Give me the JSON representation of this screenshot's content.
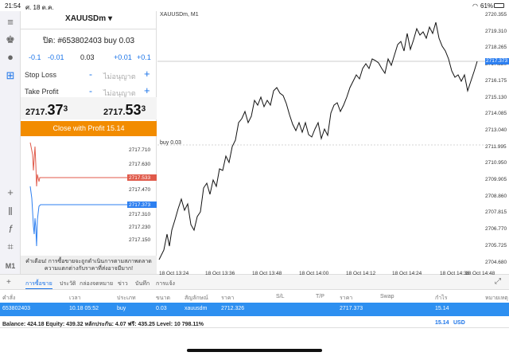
{
  "status": {
    "time": "21:54",
    "date": "ศ. 18 ต.ค.",
    "battery": "61%"
  },
  "panel": {
    "symbol": "XAUUSDm",
    "position": "ปิด: #653802403 buy 0.03",
    "vol_steps": [
      "-0.1",
      "-0.01",
      "0.03",
      "+0.01",
      "+0.1"
    ],
    "stop_loss_label": "Stop Loss",
    "take_profit_label": "Take Profit",
    "not_set": "ไม่อนุญาต",
    "bid": {
      "main": "2717.",
      "big": "37",
      "sup": "3"
    },
    "ask": {
      "main": "2717.",
      "big": "53",
      "sup": "3"
    },
    "close_button": "Close with Profit 15.14",
    "warning": "คำเตือน! การซื้อขายจะถูกดำเนินการตามสภาพตลาด ความแตกต่างกับราคาที่ส่งอาจมีมาก!",
    "mini_axis": [
      "2717.710",
      "2717.630",
      "2717.550",
      "2717.470",
      "2717.390",
      "2717.310",
      "2717.230",
      "2717.150"
    ],
    "mini_ask_tag": "2717.533",
    "mini_bid_tag": "2717.373"
  },
  "chart": {
    "label": "XAUUSDm, M1",
    "order_line_label": "buy 0.03",
    "price_tag": "2717.373",
    "y_ticks": [
      "2720.355",
      "2719.310",
      "2718.265",
      "2717.220",
      "2716.175",
      "2715.130",
      "2714.085",
      "2713.040",
      "2711.995",
      "2710.950",
      "2709.905",
      "2708.860",
      "2707.815",
      "2706.770",
      "2705.725",
      "2704.680"
    ],
    "x_ticks": [
      "18 Oct 13:24",
      "18 Oct 13:36",
      "18 Oct 13:48",
      "18 Oct 14:00",
      "18 Oct 14:12",
      "18 Oct 14:24",
      "18 Oct 14:36",
      "18 Oct 14:48"
    ]
  },
  "tabs": [
    "การซื้อขาย",
    "ประวัติ",
    "กล่องจดหมาย",
    "ข่าว",
    "บันทึก",
    "การแจ้ง"
  ],
  "table": {
    "headers": [
      "คำสั่ง",
      "เวลา",
      "ประเภท",
      "ขนาด",
      "สัญลักษณ์",
      "ราคา",
      "S/L",
      "T/P",
      "ราคา",
      "Swap",
      "กำไร",
      "หมายเหตุ"
    ],
    "row": [
      "653802403",
      "10.18 05:52",
      "buy",
      "0.03",
      "xauusdm",
      "2712.326",
      "",
      "",
      "2717.373",
      "",
      "15.14",
      ""
    ]
  },
  "balance": {
    "text": "Balance: 424.18 Equity: 439.32 หลักประกัน: 4.07 ฟรี: 435.25 Level: 10 798.11%",
    "profit": "15.14",
    "currency": "USD"
  },
  "colors": {
    "accent": "#1a73e8",
    "close_button": "#f28c00",
    "ask_line": "#e05a4a",
    "bid_line": "#2d7ff0"
  }
}
